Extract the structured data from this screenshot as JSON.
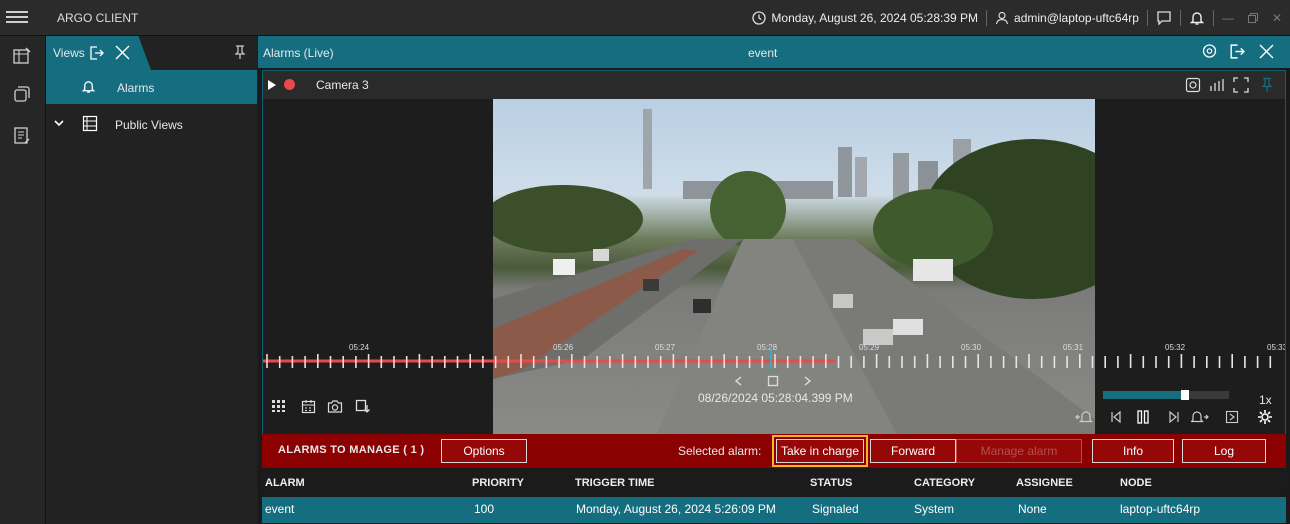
{
  "app": {
    "title": "ARGO CLIENT"
  },
  "topbar": {
    "datetime": "Monday, August 26, 2024 05:28:39 PM",
    "user": "admin@laptop-uftc64rp",
    "window_controls": [
      "minimize",
      "restore",
      "close"
    ]
  },
  "views_panel": {
    "title": "Views",
    "items": [
      {
        "label": "Alarms",
        "icon": "bell-icon",
        "selected": true
      },
      {
        "label": "Public Views",
        "icon": "list-icon",
        "expanded": true
      }
    ]
  },
  "alarms_panel": {
    "title": "Alarms (Live)",
    "center_title": "event"
  },
  "video": {
    "camera": "Camera 3",
    "timeline_labels": [
      "05:24",
      "05:26",
      "05:27",
      "05:28",
      "05:29",
      "05:30",
      "05:31",
      "05:32",
      "05:33"
    ],
    "timestamp": "08/26/2024 05:28:04.399 PM",
    "speed": "1x",
    "volume_level": 0.65
  },
  "manage_bar": {
    "title": "ALARMS TO MANAGE ( 1 )",
    "options": "Options",
    "selected_label": "Selected alarm:",
    "buttons": {
      "take": "Take in charge",
      "forward": "Forward",
      "manage": "Manage alarm",
      "info": "Info",
      "log": "Log"
    }
  },
  "table": {
    "headers": [
      "ALARM",
      "PRIORITY",
      "TRIGGER TIME",
      "STATUS",
      "CATEGORY",
      "ASSIGNEE",
      "NODE"
    ],
    "rows": [
      [
        "event",
        "100",
        "Monday, August 26, 2024 5:26:09 PM",
        "Signaled",
        "System",
        "None",
        "laptop-uftc64rp"
      ]
    ]
  },
  "colors": {
    "accent": "#156d80",
    "alarm_bar": "#8b0000",
    "highlight": "#f1b71c",
    "record": "#e84a4a"
  }
}
